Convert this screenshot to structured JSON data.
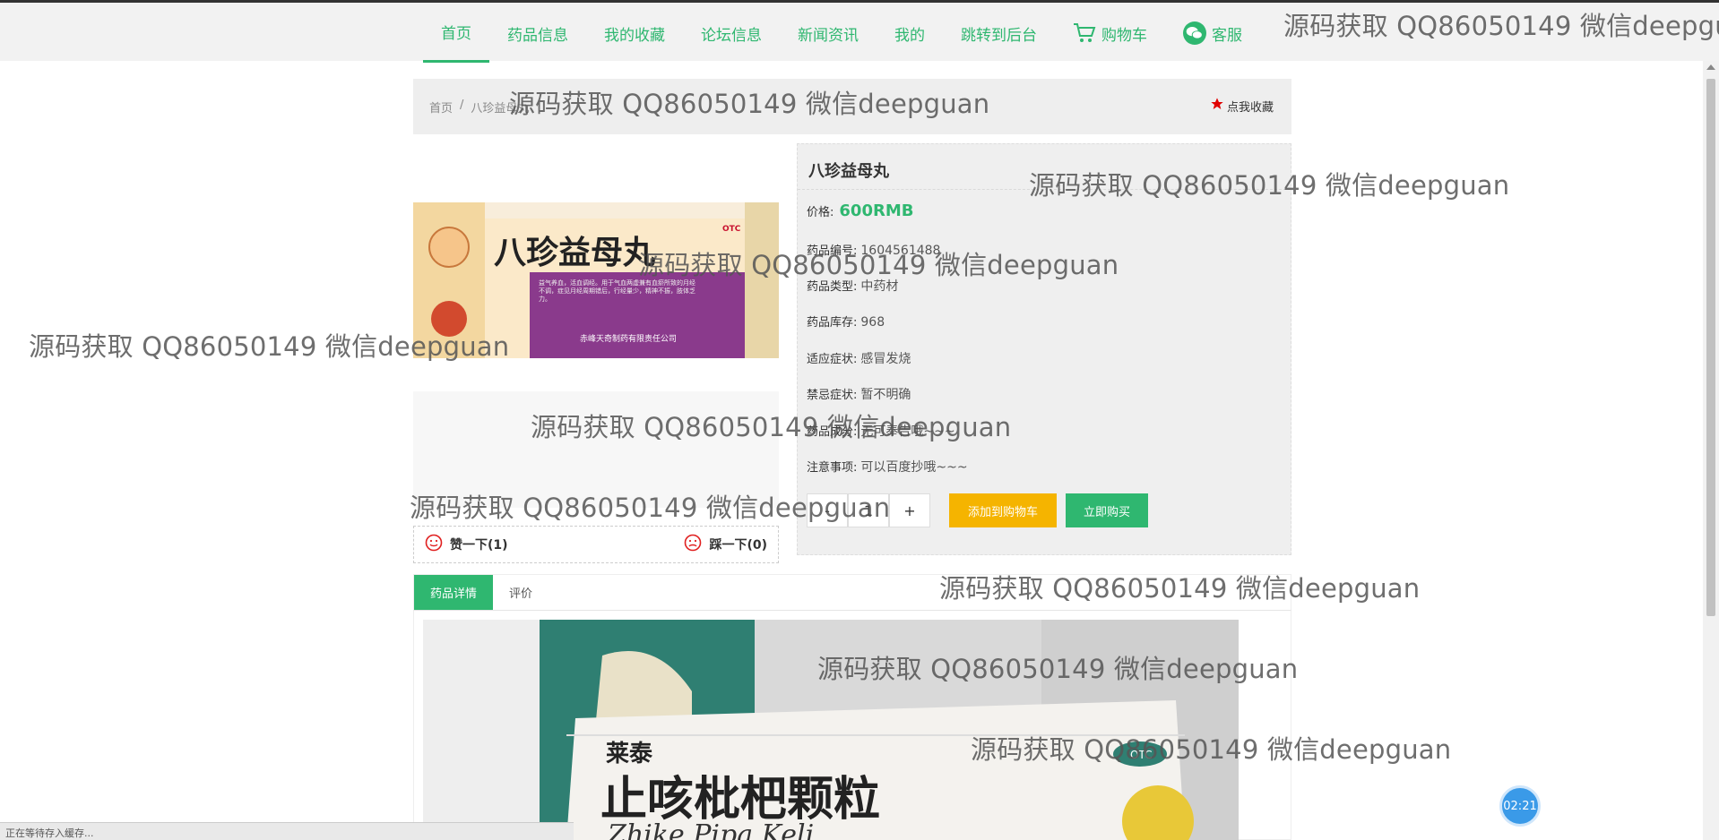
{
  "nav": {
    "items": [
      "首页",
      "药品信息",
      "我的收藏",
      "论坛信息",
      "新闻资讯",
      "我的",
      "跳转到后台"
    ],
    "cart": "购物车",
    "service": "客服"
  },
  "watermark": "源码获取 QQ86050149 微信deepguan",
  "breadcrumb": {
    "home": "首页",
    "sep": "/",
    "current": "八珍益母丸"
  },
  "favorite": "点我收藏",
  "product": {
    "name": "八珍益母丸",
    "price_label": "价格:",
    "price": "600RMB",
    "fields": [
      {
        "k": "药品编号:",
        "v": "1604561488"
      },
      {
        "k": "药品类型:",
        "v": "中药材"
      },
      {
        "k": "药品库存:",
        "v": "968"
      },
      {
        "k": "适应症状:",
        "v": "感冒发烧"
      },
      {
        "k": "禁忌症状:",
        "v": "暂不明确"
      },
      {
        "k": "药品成分:",
        "v": "无可奉告哦~~~"
      },
      {
        "k": "注意事项:",
        "v": "可以百度抄哦~~~"
      }
    ],
    "qty": {
      "minus": "-",
      "value": "1",
      "plus": "+"
    },
    "add_cart": "添加到购物车",
    "buy_now": "立即购买",
    "box_title": "八珍益母丸",
    "box_company": "赤峰天奇制药有限责任公司",
    "box_badge": "OTC",
    "box_text": "益气养血，活血调经。用于气血两虚兼有血瘀所致的月经不调，症见月经周期错后，行经量少，精神不振，肢体乏力。"
  },
  "votes": {
    "like": "赞一下(1)",
    "dislike": "踩一下(0)"
  },
  "tabs": [
    "药品详情",
    "评价"
  ],
  "detail_image": {
    "brand": "莱泰",
    "title": "止咳枇杷颗粒",
    "pinyin": "Zhike Pipa Keli",
    "badge": "OTC"
  },
  "timer": "02:21",
  "status": "正在等待存入缓存...",
  "colors": {
    "accent": "#2fb770",
    "cart_button": "#f5b400",
    "favorite_star": "#e00000"
  }
}
